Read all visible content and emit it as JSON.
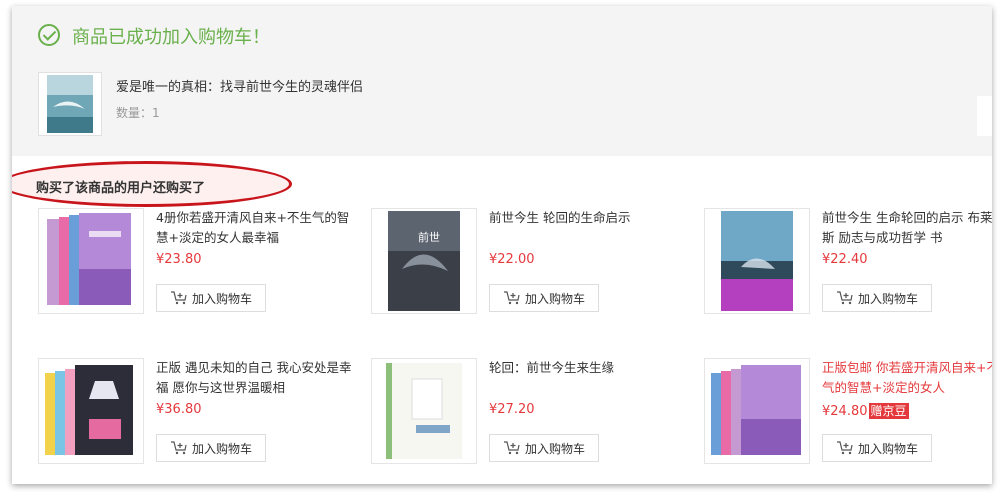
{
  "success": {
    "title": "商品已成功加入购物车！"
  },
  "added_product": {
    "title": "爱是唯一的真相：找寻前世今生的灵魂伴侣",
    "qty_label": "数量：",
    "qty_value": "1"
  },
  "recommend": {
    "heading": "购买了该商品的用户还购买了",
    "add_cart_label": "加入购物车",
    "items": [
      {
        "name": "4册你若盛开清风自来+不生气的智慧+淡定的女人最幸福",
        "price": "¥23.80"
      },
      {
        "name": "前世今生 轮回的生命启示",
        "price": "¥22.00"
      },
      {
        "name": "前世今生 生命轮回的启示 布莱恩魏斯 励志与成功哲学 书",
        "price": "¥22.40"
      },
      {
        "name": "正版 遇见未知的自己 我心安处是幸福 愿你与这世界温暖相",
        "price": "¥36.80"
      },
      {
        "name": "轮回：前世今生来生缘",
        "price": "¥27.20"
      },
      {
        "name": "正版包邮 你若盛开清风自来+不生气的智慧+淡定的女人",
        "price": "¥24.80",
        "badge": "赠京豆"
      }
    ]
  }
}
